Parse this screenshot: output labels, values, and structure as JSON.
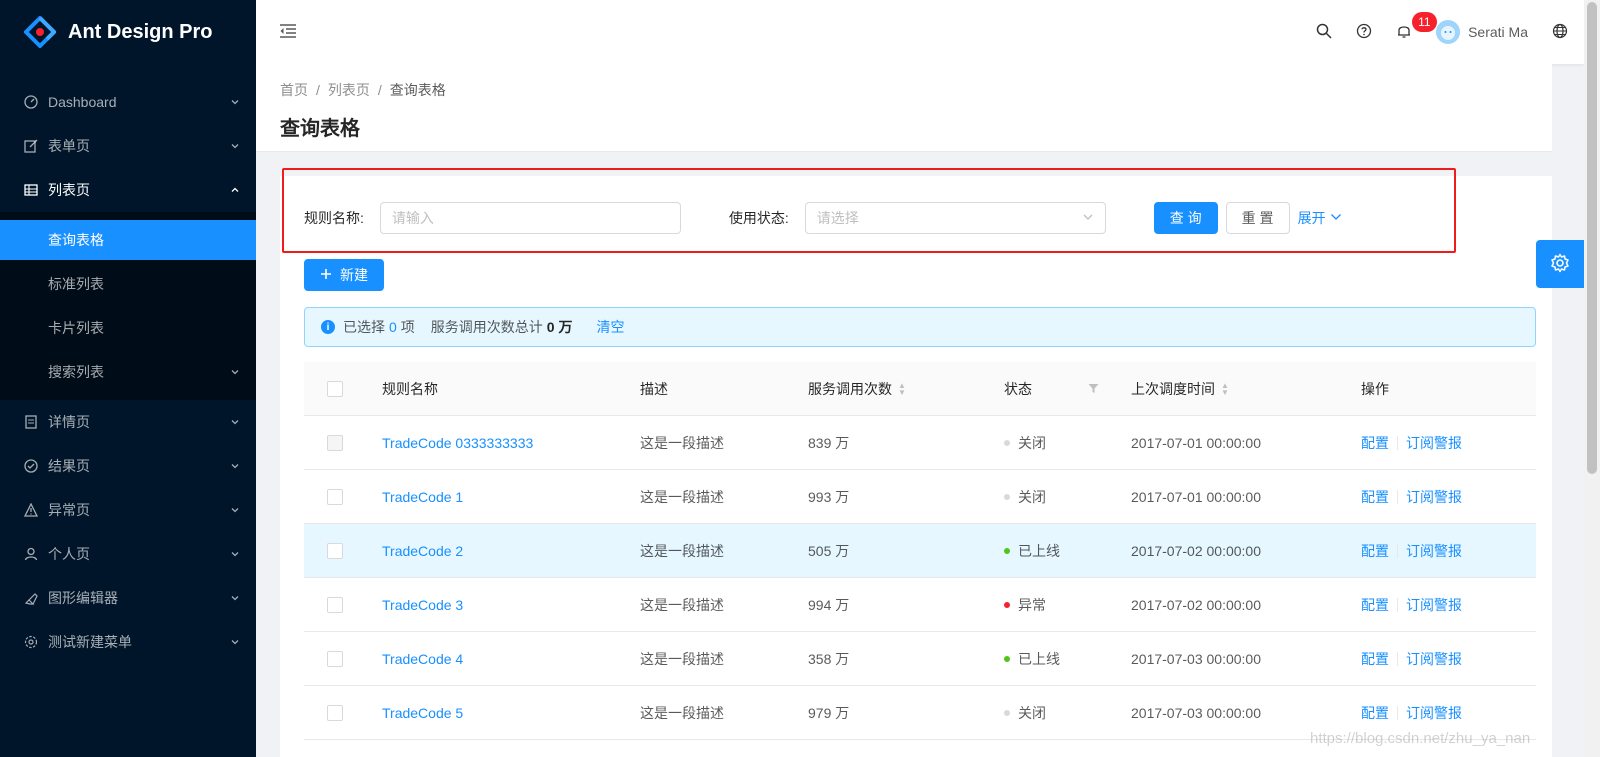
{
  "app": {
    "title": "Ant Design Pro"
  },
  "sidebar": {
    "items": [
      {
        "label": "Dashboard",
        "icon": "dashboard-icon"
      },
      {
        "label": "表单页",
        "icon": "form-icon"
      },
      {
        "label": "列表页",
        "icon": "table-icon",
        "open": true,
        "children": [
          "查询表格",
          "标准列表",
          "卡片列表",
          "搜索列表"
        ]
      },
      {
        "label": "详情页",
        "icon": "profile-icon"
      },
      {
        "label": "结果页",
        "icon": "check-circle-icon"
      },
      {
        "label": "异常页",
        "icon": "warning-icon"
      },
      {
        "label": "个人页",
        "icon": "user-icon"
      },
      {
        "label": "图形编辑器",
        "icon": "highlight-icon"
      },
      {
        "label": "测试新建菜单",
        "icon": "setting-icon"
      }
    ],
    "active_child": "查询表格"
  },
  "header": {
    "notification_count": "11",
    "user_name": "Serati Ma"
  },
  "breadcrumb": [
    "首页",
    "列表页",
    "查询表格"
  ],
  "page_title": "查询表格",
  "filter": {
    "rule_label": "规则名称:",
    "rule_placeholder": "请输入",
    "status_label": "使用状态:",
    "status_placeholder": "请选择",
    "query_button": "查 询",
    "reset_button": "重 置",
    "expand_link": "展开"
  },
  "new_button": "新建",
  "alert": {
    "prefix": "已选择",
    "selected_count": "0",
    "unit": "项",
    "service_total_label": "服务调用次数总计",
    "service_total_value": "0 万",
    "clear_link": "清空"
  },
  "table": {
    "columns": [
      "规则名称",
      "描述",
      "服务调用次数",
      "状态",
      "上次调度时间",
      "操作"
    ],
    "rows": [
      {
        "name": "TradeCode 0333333333",
        "desc": "这是一段描述",
        "calls": "839 万",
        "status": "关闭",
        "status_color": "#d9d9d9",
        "time": "2017-07-01 00:00:00",
        "op1": "配置",
        "op2": "订阅警报",
        "disabled": true
      },
      {
        "name": "TradeCode 1",
        "desc": "这是一段描述",
        "calls": "993 万",
        "status": "关闭",
        "status_color": "#d9d9d9",
        "time": "2017-07-01 00:00:00",
        "op1": "配置",
        "op2": "订阅警报"
      },
      {
        "name": "TradeCode 2",
        "desc": "这是一段描述",
        "calls": "505 万",
        "status": "已上线",
        "status_color": "#52c41a",
        "time": "2017-07-02 00:00:00",
        "op1": "配置",
        "op2": "订阅警报",
        "hover": true
      },
      {
        "name": "TradeCode 3",
        "desc": "这是一段描述",
        "calls": "994 万",
        "status": "异常",
        "status_color": "#f5222d",
        "time": "2017-07-02 00:00:00",
        "op1": "配置",
        "op2": "订阅警报"
      },
      {
        "name": "TradeCode 4",
        "desc": "这是一段描述",
        "calls": "358 万",
        "status": "已上线",
        "status_color": "#52c41a",
        "time": "2017-07-03 00:00:00",
        "op1": "配置",
        "op2": "订阅警报"
      },
      {
        "name": "TradeCode 5",
        "desc": "这是一段描述",
        "calls": "979 万",
        "status": "关闭",
        "status_color": "#d9d9d9",
        "time": "2017-07-03 00:00:00",
        "op1": "配置",
        "op2": "订阅警报"
      }
    ]
  },
  "watermark": "https://blog.csdn.net/zhu_ya_nan",
  "colors": {
    "primary": "#1890ff",
    "sider_bg": "#001529",
    "highlight_border": "#ee1c1c"
  }
}
